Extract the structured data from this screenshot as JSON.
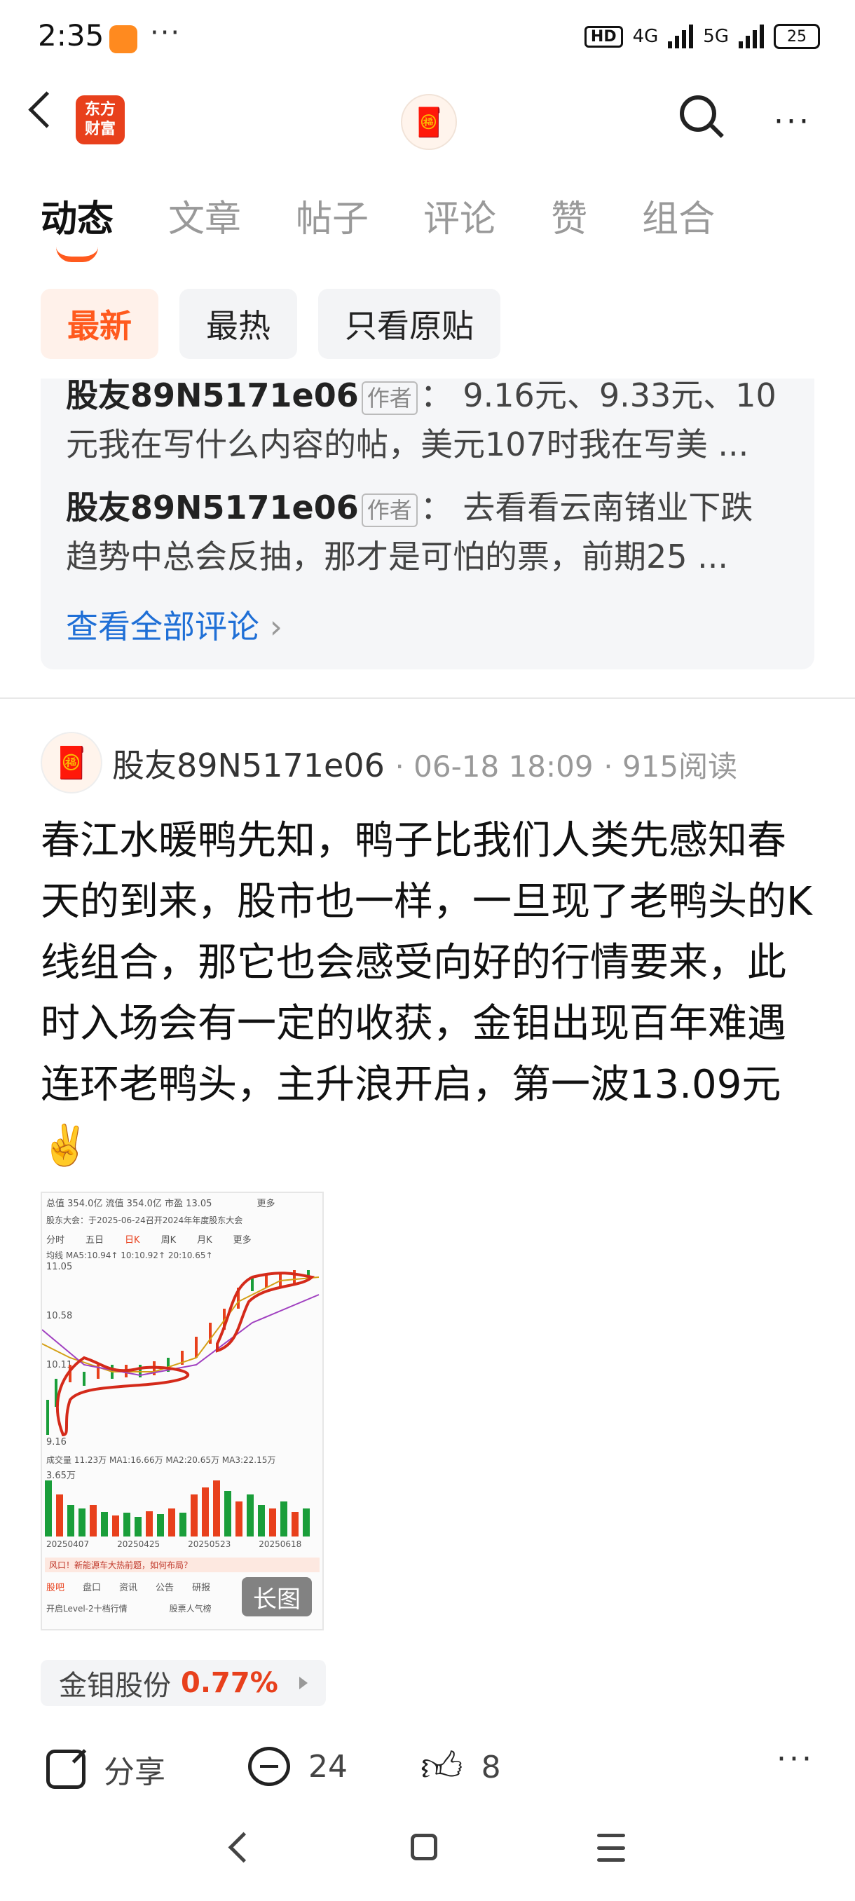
{
  "status_bar": {
    "time": "2:35",
    "more_dots": "···",
    "hd_label": "HD",
    "network_4g": "4G",
    "network_5g": "5G",
    "battery": "25"
  },
  "header": {
    "logo_line1": "东方",
    "logo_line2": "财富",
    "more_dots": "···"
  },
  "tabs": [
    {
      "label": "动态",
      "active": true
    },
    {
      "label": "文章"
    },
    {
      "label": "帖子"
    },
    {
      "label": "评论"
    },
    {
      "label": "赞"
    },
    {
      "label": "组合"
    }
  ],
  "filters": [
    {
      "label": "最新",
      "active": true
    },
    {
      "label": "最热"
    },
    {
      "label": "只看原贴"
    }
  ],
  "comments": {
    "items": [
      {
        "author": "股友89N5171e06",
        "tag": "作者",
        "text": "9.16元、9.33元、10元我在写什么内容的帖，美元107时我在写美 ..."
      },
      {
        "author": "股友89N5171e06",
        "tag": "作者",
        "text": "去看看云南锗业下跌趋势中总会反抽，那才是可怕的票，前期25  ..."
      }
    ],
    "line1": "：  9.16元、9.33元、10",
    "line2": "元我在写什么内容的帖，美元107时我在写美 ...",
    "line3": "：  去看看云南锗业下跌",
    "line4": "趋势中总会反抽，那才是可怕的票，前期25  ...",
    "view_all": "查看全部评论"
  },
  "post": {
    "author": "股友89N5171e06",
    "datetime": "06-18 18:09",
    "reads": "915阅读",
    "text": "春江水暖鸭先知，鸭子比我们人类先感知春天的到来，股市也一样，一旦现了老鸭头的K线组合，那它也会感受向好的行情要来，此时入场会有一定的收获，金钼出现百年难遇连环老鸭头，主升浪开启，第一波13.09元✌️",
    "image": {
      "total_cap_label": "总值",
      "total_cap": "354.0亿",
      "float_cap_label": "流值",
      "float_cap": "354.0亿",
      "pe_label": "市盈",
      "pe": "13.05",
      "more": "更多",
      "notice": "股东大会：于2025-06-24召开2024年年度股东大会",
      "periods": [
        "分时",
        "五日",
        "日K",
        "周K",
        "月K",
        "更多"
      ],
      "ma_line": "均线 MA5:10.94↑ 10:10.92↑ 20:10.65↑",
      "price_high": "11.05",
      "price_mid1": "10.58",
      "price_mid2": "10.11",
      "price_low": "9.16",
      "vol_line": "成交量 11.23万 MA1:16.66万 MA2:20.65万 MA3:22.15万",
      "vol_val": "3.65万",
      "dates": [
        "20250407",
        "20250425",
        "20250523",
        "20250618"
      ],
      "banner": "风口！新能源车大热前题，如何布局？",
      "bottom_tabs": [
        "股吧",
        "盘口",
        "资讯",
        "公告",
        "研报"
      ],
      "bottom_items": [
        "开启Level-2十档行情",
        "股票人气榜"
      ],
      "long_image_tag": "长图"
    },
    "stock": {
      "name": "金钼股份",
      "change": "0.77%"
    },
    "actions": {
      "share": "分享",
      "comments": "24",
      "likes": "8",
      "more": "···"
    }
  },
  "colors": {
    "accent": "#ff5a1e",
    "brand_logo": "#e8401c",
    "link": "#1f6fd6",
    "up_red": "#e8401c"
  }
}
